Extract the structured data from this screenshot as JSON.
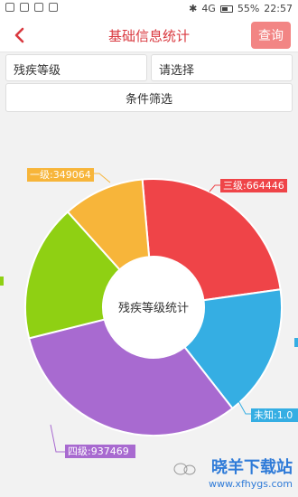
{
  "status_bar": {
    "battery": "55%",
    "time": "22:57",
    "network": "4G"
  },
  "navbar": {
    "title": "基础信息统计",
    "query_label": "查询"
  },
  "filters": {
    "field1": "残疾等级",
    "field2": "请选择",
    "filter_button": "条件筛选"
  },
  "chart_data": {
    "type": "pie",
    "center_label": "残疾等级统计",
    "slices": [
      {
        "label": "三级:664446",
        "category": "三级",
        "value": 664446,
        "color": "#ef4448"
      },
      {
        "label": "未知:1.0",
        "category": "未知",
        "value": 1.0,
        "color": "#35aee3"
      },
      {
        "label": "四级:937469",
        "category": "四级",
        "value": 937469,
        "color": "#a86ad0"
      },
      {
        "label": "",
        "category": "",
        "value": 520000,
        "color": "#8fd013"
      },
      {
        "label": "一级:349064",
        "category": "一级",
        "value": 349064,
        "color": "#f7b53a"
      }
    ]
  },
  "watermark": {
    "logo": "晓羊下载站",
    "url": "www.xfhygs.com"
  }
}
